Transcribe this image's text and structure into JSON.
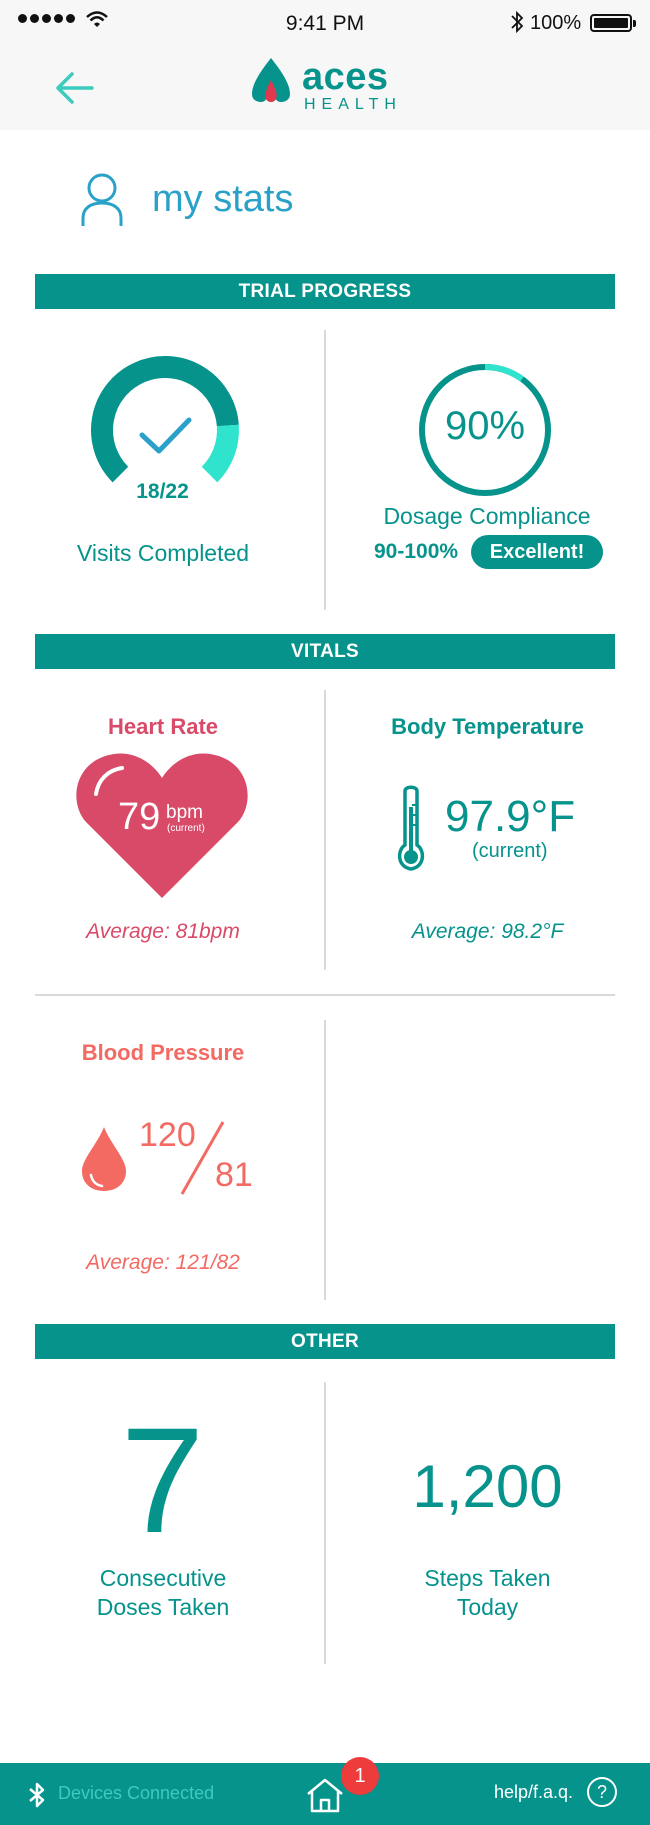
{
  "status_bar": {
    "time": "9:41 PM",
    "battery": "100%"
  },
  "nav": {
    "back_icon": "arrow-left-icon",
    "brand": "aces",
    "brand_sub": "HEALTH"
  },
  "page": {
    "title": "my stats",
    "icon": "user-icon"
  },
  "trial_progress": {
    "header": "TRIAL PROGRESS",
    "visits": {
      "count": "18/22",
      "completed": 18,
      "total": 22,
      "label": "Visits Completed"
    },
    "dosage": {
      "percent_text": "90%",
      "percent": 0.9,
      "label": "Dosage Compliance",
      "range": "90-100%",
      "rating": "Excellent!"
    }
  },
  "vitals": {
    "header": "VITALS",
    "heart_rate": {
      "title": "Heart Rate",
      "value": "79",
      "unit": "bpm",
      "qualifier": "(current)",
      "average": "Average: 81bpm"
    },
    "body_temperature": {
      "title": "Body Temperature",
      "value": "97.9°F",
      "qualifier": "(current)",
      "average": "Average: 98.2°F"
    },
    "blood_pressure": {
      "title": "Blood Pressure",
      "systolic": "120",
      "diastolic": "81",
      "average": "Average: 121/82"
    }
  },
  "other": {
    "header": "OTHER",
    "doses": {
      "value": "7",
      "label_line1": "Consecutive",
      "label_line2": "Doses Taken"
    },
    "steps": {
      "value": "1,200",
      "label_line1": "Steps Taken",
      "label_line2": "Today"
    }
  },
  "footer": {
    "devices": "Devices Connected",
    "notifications": "1",
    "help": "help/f.a.q.",
    "help_icon": "?"
  },
  "colors": {
    "teal": "#05938c",
    "accent_teal": "#2fe3cc",
    "heart": "#d94a68",
    "pressure": "#f26a62",
    "blue": "#2aa1c8"
  }
}
